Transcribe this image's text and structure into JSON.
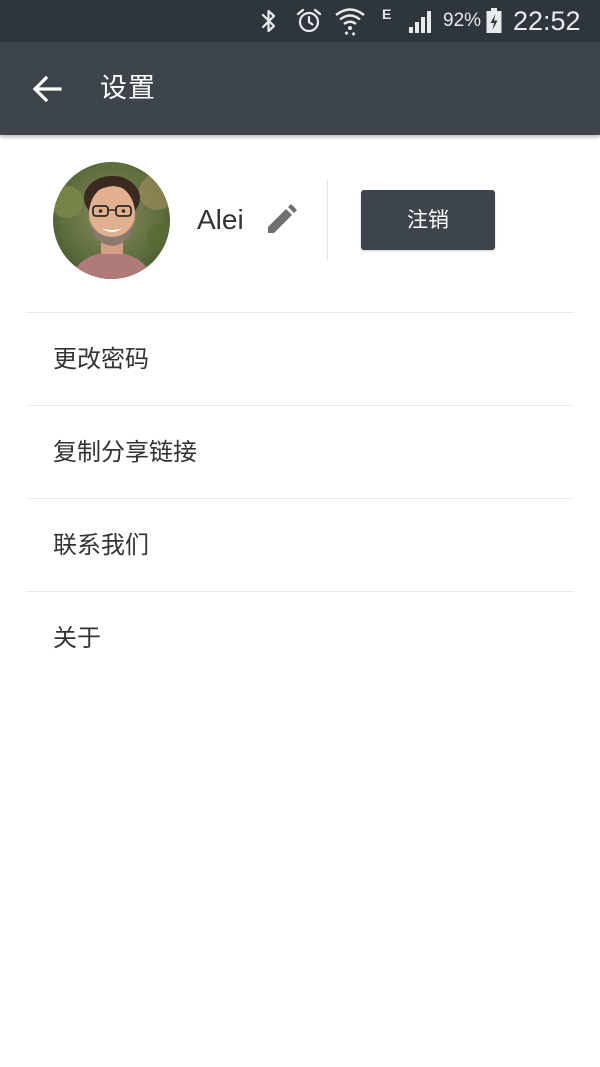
{
  "status_bar": {
    "network_type": "E",
    "battery_percent": "92%",
    "time": "22:52",
    "icons": [
      "bluetooth-icon",
      "alarm-icon",
      "wifi-icon",
      "signal-icon",
      "battery-charging-icon"
    ]
  },
  "app_bar": {
    "back_icon": "arrow-back-icon",
    "title": "设置"
  },
  "profile": {
    "username": "Alei",
    "edit_icon": "pencil-icon",
    "logout_label": "注销"
  },
  "menu": {
    "items": [
      {
        "label": "更改密码"
      },
      {
        "label": "复制分享链接"
      },
      {
        "label": "联系我们"
      },
      {
        "label": "关于"
      }
    ]
  },
  "colors": {
    "status_bar": "#2f353c",
    "app_bar": "#3d444b",
    "button": "#3d444b",
    "divider": "#e8e8e8"
  }
}
